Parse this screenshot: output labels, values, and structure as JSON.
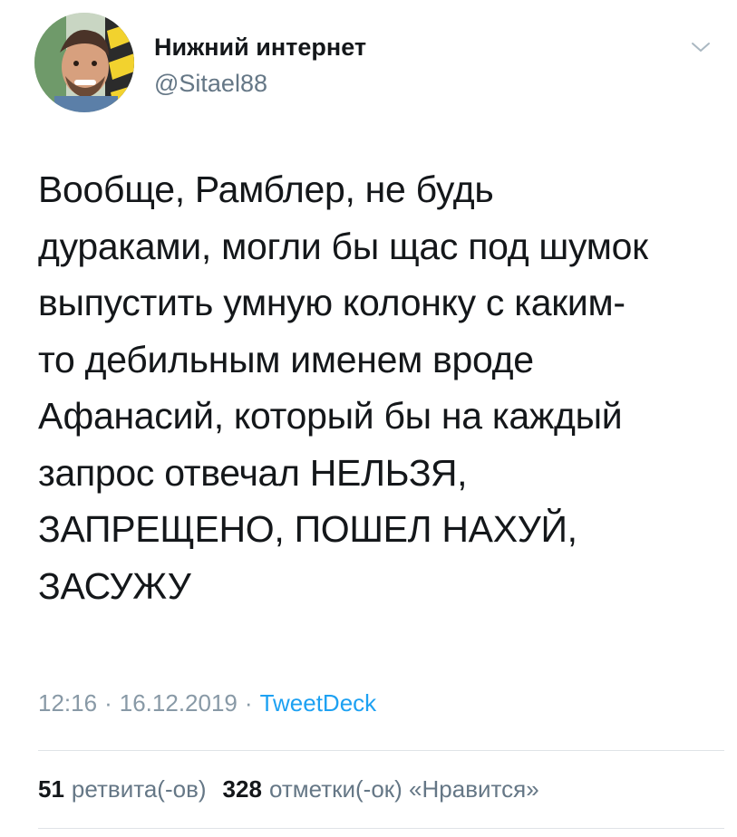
{
  "author": {
    "display_name": "Нижний интернет",
    "handle": "@Sitael88"
  },
  "tweet": {
    "text": "Вообще, Рамблер, не будь\nдураками, могли бы щас под шумок\nвыпустить умную колонку с каким-\nто дебильным именем вроде\nАфанасий, который бы на каждый\nзапрос отвечал НЕЛЬЗЯ,\nЗАПРЕЩЕНО, ПОШЕЛ НАХУЙ,\nЗАСУЖУ",
    "time": "12:16",
    "date": "16.12.2019",
    "separator": "·",
    "source": "TweetDeck"
  },
  "stats": {
    "retweets_count": "51",
    "retweets_label": "ретвита(-ов)",
    "likes_count": "328",
    "likes_label": "отметки(-ок) «Нравится»"
  },
  "icons": {
    "menu": "chevron-down-icon"
  },
  "colors": {
    "text_primary": "#14171a",
    "text_secondary": "#657786",
    "meta": "#8899a6",
    "link": "#1da1f2",
    "divider": "#dfe3e7"
  }
}
